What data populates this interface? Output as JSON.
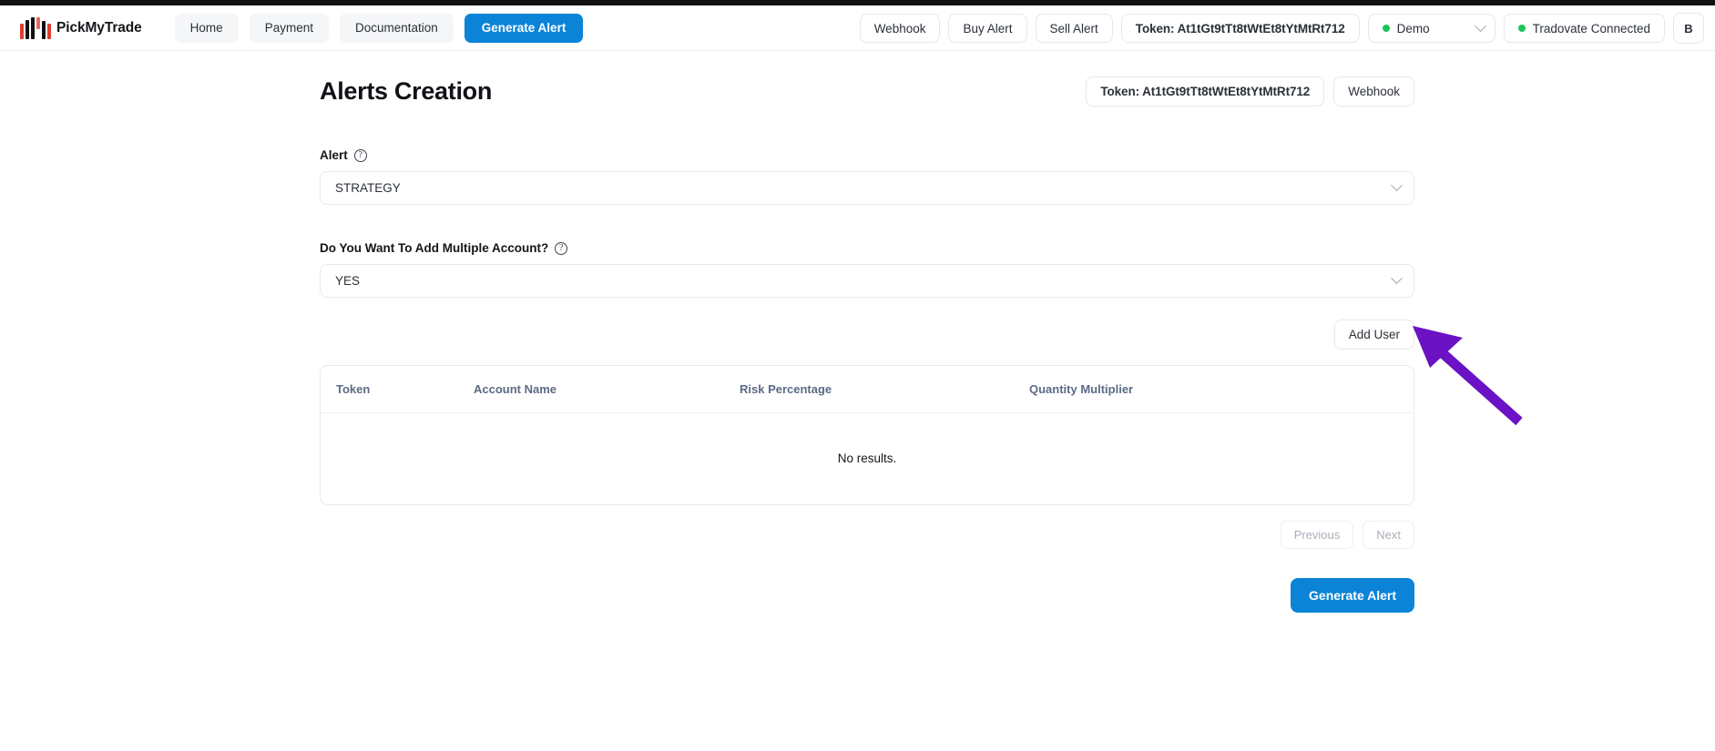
{
  "navbar": {
    "brand": "PickMyTrade",
    "links": [
      {
        "label": "Home",
        "style": "ghost"
      },
      {
        "label": "Payment",
        "style": "ghost"
      },
      {
        "label": "Documentation",
        "style": "ghost"
      },
      {
        "label": "Generate Alert",
        "style": "primary"
      }
    ],
    "webhook_label": "Webhook",
    "buy_alert_label": "Buy Alert",
    "sell_alert_label": "Sell Alert",
    "token_label": "Token: At1tGt9tTt8tWtEt8tYtMtRt712",
    "environment": "Demo",
    "broker_status": "Tradovate Connected",
    "avatar_initial": "B",
    "accent_color": "#0b84d8",
    "status_dot_color": "#1cc55a"
  },
  "header": {
    "title": "Alerts Creation",
    "token_button": "Token: At1tGt9tTt8tWtEt8tYtMtRt712",
    "webhook_button": "Webhook"
  },
  "form": {
    "alert": {
      "label": "Alert",
      "help_icon": "help-circle-icon",
      "value": "STRATEGY"
    },
    "multiple_account": {
      "label": "Do You Want To Add Multiple Account?",
      "help_icon": "help-circle-icon",
      "value": "YES"
    },
    "add_user_button": "Add User"
  },
  "table": {
    "columns": [
      "Token",
      "Account Name",
      "Risk Percentage",
      "Quantity Multiplier"
    ],
    "rows": [],
    "empty_message": "No results."
  },
  "pagination": {
    "previous": "Previous",
    "next": "Next"
  },
  "footer": {
    "submit_label": "Generate Alert"
  },
  "annotation": {
    "color": "#6b12c4",
    "type": "arrow",
    "points_to": "add-user-button"
  }
}
